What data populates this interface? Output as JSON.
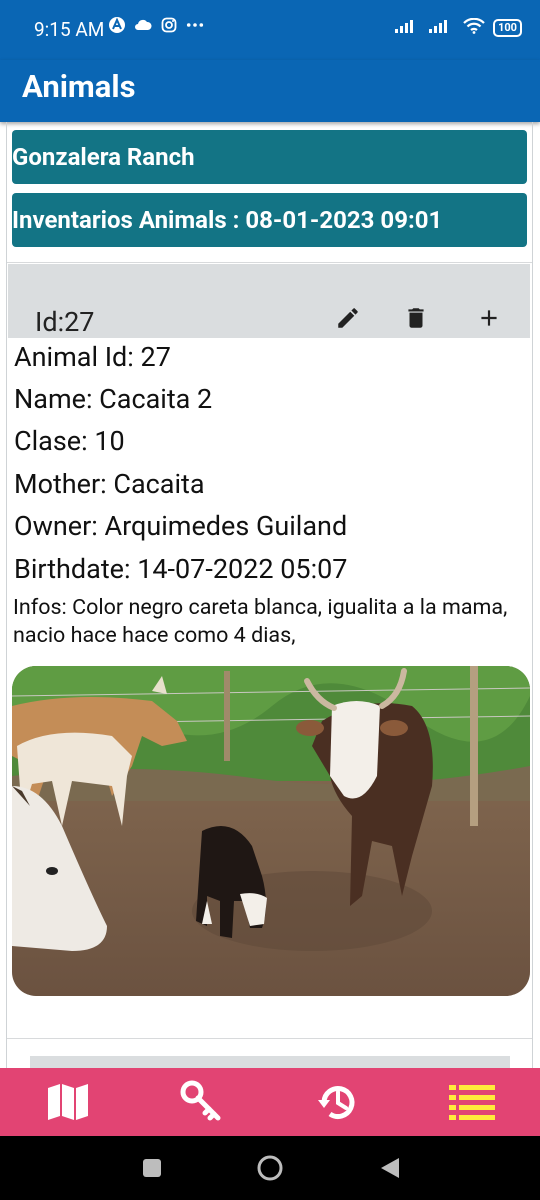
{
  "status": {
    "time": "9:15 AM",
    "battery": "100",
    "colors": {
      "bar": "#0a66b4"
    }
  },
  "appbar": {
    "title": "Animals"
  },
  "banners": {
    "ranch": "Gonzalera Ranch",
    "inventory": "Inventarios Animals : 08-01-2023 09:01",
    "color": "#137485"
  },
  "card": {
    "header_id": "Id:27",
    "actions": [
      "edit-icon",
      "delete-icon",
      "add-icon"
    ],
    "fields": {
      "animal_id": "Animal Id: 27",
      "name": "Name: Cacaita 2",
      "clase": "Clase: 10",
      "mother": "Mother: Cacaita",
      "owner": "Owner: Arquimedes Guiland",
      "birthdate": "Birthdate: 14-07-2022 05:07"
    },
    "infos": "Infos: Color negro careta blanca, igualita a la mama,  nacio hace hace como 4 dias,"
  },
  "bottom_nav": {
    "items": [
      "map-icon",
      "key-icon",
      "history-icon",
      "list-icon"
    ],
    "color": "#e24473",
    "active_color": "#ffeb3b"
  },
  "system_nav": [
    "recents-button",
    "home-button",
    "back-button"
  ]
}
